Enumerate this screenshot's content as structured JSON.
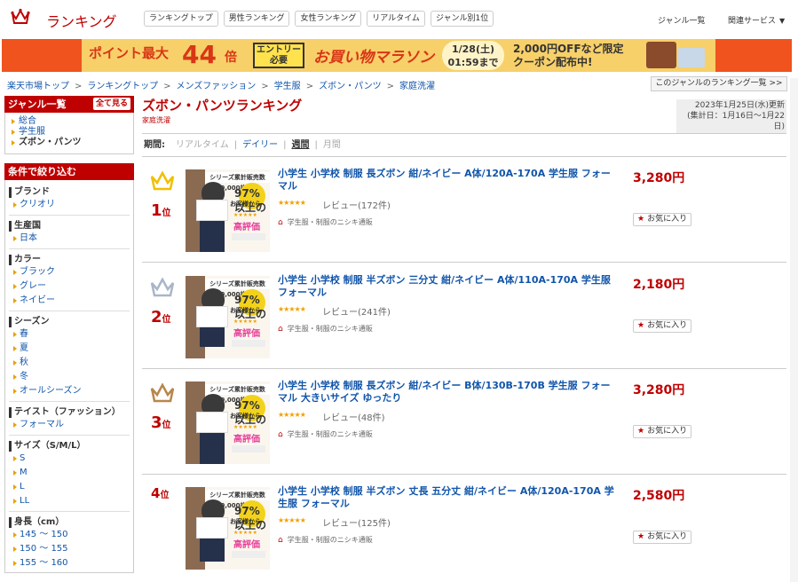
{
  "header": {
    "logo_text": "ランキング",
    "nav": [
      "ランキングトップ",
      "男性ランキング",
      "女性ランキング",
      "リアルタイム",
      "ジャンル別1位"
    ],
    "genre_list": "ジャンル一覧",
    "related": "関連サービス"
  },
  "banner": {
    "point": "ポイント最大",
    "num": "44",
    "bai": "倍",
    "entry_l1": "エントリー",
    "entry_l2": "必要",
    "marathon": "お買い物マラソン",
    "date_l1": "1/28(土)",
    "date_l2": "01:59まで",
    "coupon_l1": "2,000円OFFなど限定",
    "coupon_l2": "クーポン配布中!"
  },
  "breadcrumb": [
    "楽天市場トップ",
    "ランキングトップ",
    "メンズファッション",
    "学生服",
    "ズボン・パンツ",
    "家庭洗濯"
  ],
  "genre_rank_link": "このジャンルのランキング一覧 >>",
  "sidebar": {
    "genre_head": "ジャンル一覧",
    "see_all": "全て見る",
    "genres": [
      "総合",
      "学生服",
      "ズボン・パンツ"
    ],
    "filter_head": "条件で絞り込む",
    "filters": [
      {
        "cat": "ブランド",
        "items": [
          "クリオリ"
        ]
      },
      {
        "cat": "生産国",
        "items": [
          "日本"
        ]
      },
      {
        "cat": "カラー",
        "items": [
          "ブラック",
          "グレー",
          "ネイビー"
        ]
      },
      {
        "cat": "シーズン",
        "items": [
          "春",
          "夏",
          "秋",
          "冬",
          "オールシーズン"
        ]
      },
      {
        "cat": "テイスト（ファッション）",
        "items": [
          "フォーマル"
        ]
      },
      {
        "cat": "サイズ（S/M/L）",
        "items": [
          "S",
          "M",
          "L",
          "LL"
        ]
      },
      {
        "cat": "身長（cm）",
        "items": [
          "145 ～ 150",
          "150 ～ 155",
          "155 ～ 160"
        ]
      }
    ]
  },
  "main": {
    "title": "ズボン・パンツランキング",
    "subtitle": "家庭洗濯",
    "updated_l1": "2023年1月25日(水)更新",
    "updated_l2": "(集計日：1月16日～1月22日)",
    "period_label": "期間:",
    "periods": [
      "リアルタイム",
      "デイリー",
      "週間",
      "月間"
    ]
  },
  "thumb": {
    "top": "シリーズ累計販売数 60,000枚突破",
    "p97": "97%以上の",
    "cust": "お客様から",
    "high": "高評価"
  },
  "items": [
    {
      "rank": "1",
      "unit": "位",
      "title": "小学生 小学校 制服 長ズボン 紺/ネイビー A体/120A-170A 学生服 フォーマル",
      "review": "レビュー(172件)",
      "shop": "学生服・制服のニシキ通販",
      "price": "3,280円",
      "fav": "お気に入り",
      "crown_color": "#f0c000"
    },
    {
      "rank": "2",
      "unit": "位",
      "title": "小学生 小学校 制服 半ズボン 三分丈 紺/ネイビー A体/110A-170A 学生服 フォーマル",
      "review": "レビュー(241件)",
      "shop": "学生服・制服のニシキ通販",
      "price": "2,180円",
      "fav": "お気に入り",
      "crown_color": "#a9b6c8"
    },
    {
      "rank": "3",
      "unit": "位",
      "title": "小学生 小学校 制服 長ズボン 紺/ネイビー B体/130B-170B 学生服 フォーマル 大きいサイズ ゆったり",
      "review": "レビュー(48件)",
      "shop": "学生服・制服のニシキ通販",
      "price": "3,280円",
      "fav": "お気に入り",
      "crown_color": "#b8864a"
    },
    {
      "rank": "4",
      "unit": "位",
      "title": "小学生 小学校 制服 半ズボン 丈長 五分丈 紺/ネイビー A体/120A-170A 学生服 フォーマル",
      "review": "レビュー(125件)",
      "shop": "学生服・制服のニシキ通販",
      "price": "2,580円",
      "fav": "お気に入り",
      "crown_color": ""
    }
  ]
}
